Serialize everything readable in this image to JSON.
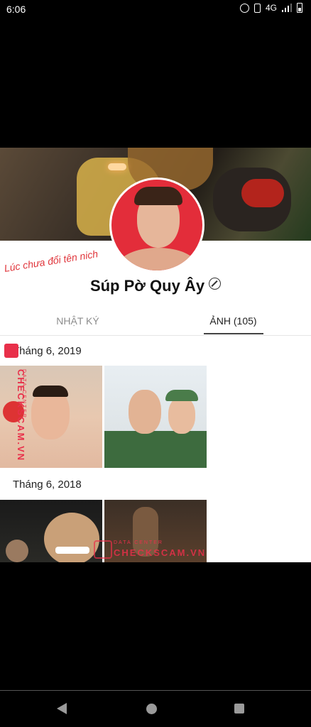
{
  "status_bar": {
    "time": "6:06",
    "network": "4G",
    "icons": [
      "alarm-icon",
      "vibrate-icon",
      "signal-icon",
      "battery-icon"
    ]
  },
  "profile": {
    "name": "Súp Pờ Quy Ây",
    "annotation": "Lúc chưa đổi tên nich",
    "edit_icon": "edit-icon"
  },
  "tabs": {
    "journal": "NHẬT KÝ",
    "photos": "ẢNH (105)",
    "active": "photos"
  },
  "albums": [
    {
      "title": "Tháng 6, 2019"
    },
    {
      "title": "Tháng 6, 2018"
    }
  ],
  "watermark": {
    "small": "DATA CENTER",
    "big": "CHECKSCAM.VN"
  },
  "nav": {
    "icons": [
      "back-icon",
      "home-icon",
      "recents-icon"
    ]
  },
  "colors": {
    "annotation": "#e0353b",
    "watermark": "#e8304a",
    "avatar_bg": "#e32d3a"
  }
}
